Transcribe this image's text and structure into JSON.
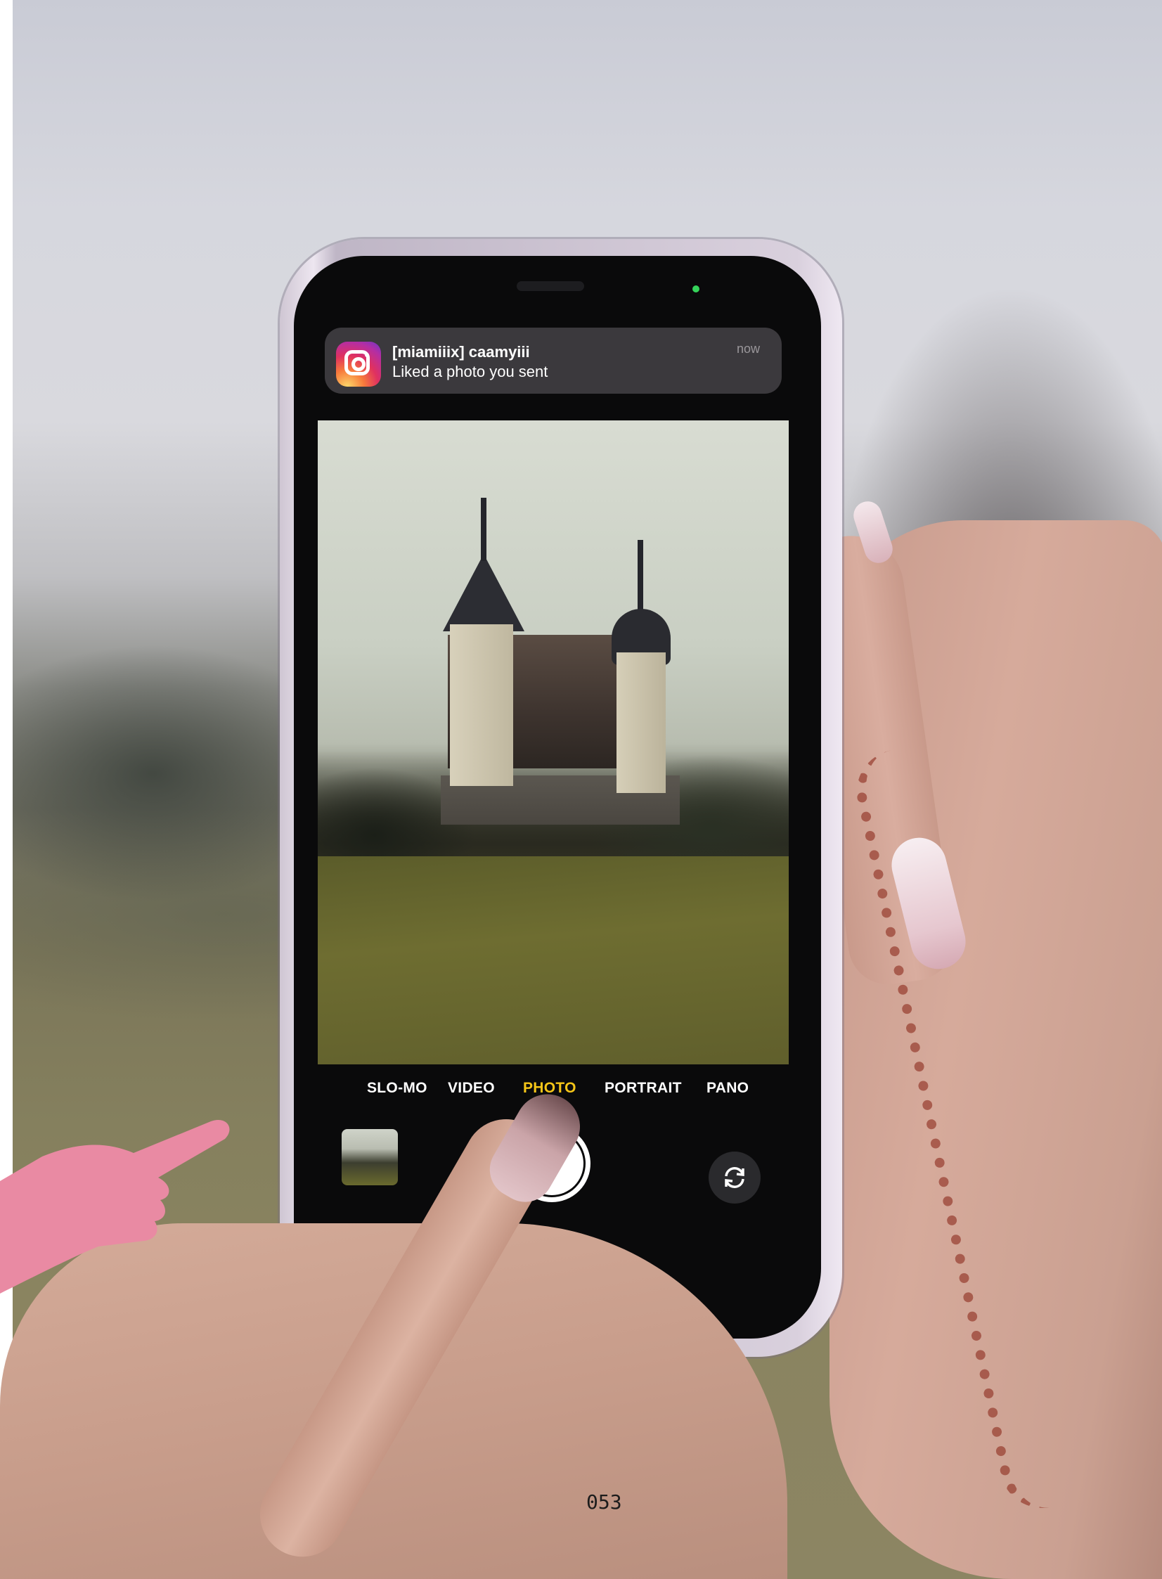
{
  "notification": {
    "app_icon": "instagram-icon",
    "title": "[miamiiix] caamyiii",
    "body": "Liked a photo you sent",
    "time": "now"
  },
  "camera": {
    "modes": [
      {
        "label": "SLO-MO",
        "active": false
      },
      {
        "label": "VIDEO",
        "active": false
      },
      {
        "label": "PHOTO",
        "active": true
      },
      {
        "label": "PORTRAIT",
        "active": false
      },
      {
        "label": "PANO",
        "active": false
      }
    ],
    "controls": {
      "thumbnail_icon": "last-photo-thumbnail",
      "shutter_icon": "shutter-button",
      "flip_icon": "flip-camera-icon"
    },
    "active_color": "#f5c518"
  },
  "decoration": {
    "pointer_icon": "pointing-hand-icon",
    "pointer_color": "#e98aa3"
  },
  "page": {
    "number": "053"
  }
}
